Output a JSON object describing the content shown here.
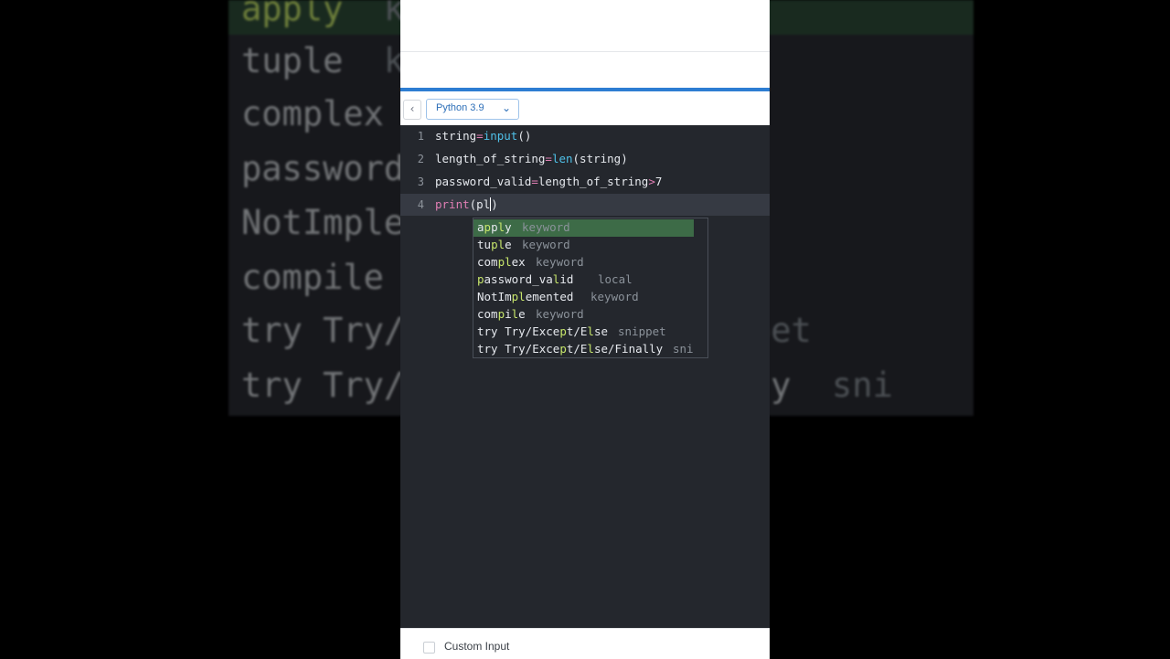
{
  "toolbar": {
    "language": "Python 3.9",
    "back_icon": "chevron-left-icon",
    "dropdown_icon": "chevron-down-icon"
  },
  "editor": {
    "lines": [
      {
        "number": "1",
        "code": "string=input()"
      },
      {
        "number": "2",
        "code": "length_of_string=len(string)"
      },
      {
        "number": "3",
        "code": "password_valid=length_of_string>7"
      },
      {
        "number": "4",
        "code": "print(pl)"
      }
    ],
    "line_1": {
      "var": "string",
      "eq": "=",
      "fn": "input",
      "rest": "()"
    },
    "line_2": {
      "var": "length_of_string",
      "eq": "=",
      "fn": "len",
      "rest": "(string)"
    },
    "line_3": {
      "var": "password_valid",
      "eq": "=",
      "lhs": "length_of_string",
      "gt": ">",
      "num": "7"
    },
    "line_4": {
      "fn": "print",
      "open": "(",
      "typed": "pl",
      "close": ")"
    }
  },
  "autocomplete": {
    "items": [
      {
        "name": "apply",
        "kind": "keyword"
      },
      {
        "name": "tuple",
        "kind": "keyword"
      },
      {
        "name": "complex",
        "kind": "keyword"
      },
      {
        "name": "password_valid",
        "kind": "local"
      },
      {
        "name": "NotImplemented",
        "kind": "keyword"
      },
      {
        "name": "compile",
        "kind": "keyword"
      },
      {
        "name": "try Try/Except/Else",
        "kind": "snippet"
      },
      {
        "name": "try Try/Except/Else/Finally",
        "kind": "sni"
      }
    ],
    "selected_index": 0
  },
  "footer": {
    "custom_input_label": "Custom Input"
  },
  "colors": {
    "accent": "#2d7dd2",
    "editor_bg": "#24272d",
    "match_highlight": "#c7e66b",
    "selected_row": "#3d6b47"
  }
}
